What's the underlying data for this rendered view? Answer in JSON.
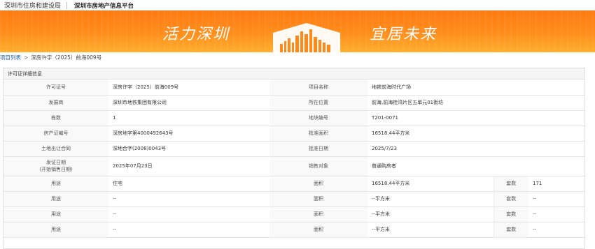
{
  "header": {
    "site_name": "深圳市住房和建设局",
    "platform_name": "深圳市房地产信息平台"
  },
  "banner": {
    "slogan_left": "活力深圳",
    "slogan_right": "宜居未来"
  },
  "breadcrumb": {
    "root": "项目列表",
    "separator": ">",
    "current": "深房许字（2025）前海009号"
  },
  "panel": {
    "title": "许可证详细信息"
  },
  "details": {
    "license_no_label": "许可证号",
    "license_no": "深房许字（2025）前海009号",
    "project_name_label": "项目名称",
    "project_name": "地铁前海时代广场",
    "developer_label": "发展商",
    "developer": "深圳市地铁集团有限公司",
    "location_label": "所在位置",
    "location": "前海,前海桂湾片区五单元01街坊",
    "building_count_label": "栋数",
    "building_count": "1",
    "plot_no_label": "地块编号",
    "plot_no": "T201-0071",
    "property_cert_label": "房产证编号",
    "property_cert": "深房地字第4000492643号",
    "approved_area_label": "批准面积",
    "approved_area": "16518.44平方米",
    "land_contract_label": "土地出让合同",
    "land_contract": "深地合字(2008)0043号",
    "approval_date_label": "批准日期",
    "approval_date": "2025/7/23",
    "issue_date_label_1": "发证日期",
    "issue_date_label_2": "(开始销售日期)",
    "issue_date": "2025年07月23日",
    "sales_target_label": "销售对象",
    "sales_target": "普通购房者"
  },
  "usage_rows": [
    {
      "usage_label": "用途",
      "usage": "住宅",
      "area_label": "面积",
      "area": "16518.44平方米",
      "units_label": "套数",
      "units": "171"
    },
    {
      "usage_label": "用途",
      "usage": "--",
      "area_label": "面积",
      "area": "--平方米",
      "units_label": "套数",
      "units": "--"
    },
    {
      "usage_label": "用途",
      "usage": "--",
      "area_label": "面积",
      "area": "--平方米",
      "units_label": "套数",
      "units": "--"
    },
    {
      "usage_label": "用途",
      "usage": "--",
      "area_label": "面积",
      "area": "--平方米",
      "units_label": "套数",
      "units": "--"
    }
  ]
}
